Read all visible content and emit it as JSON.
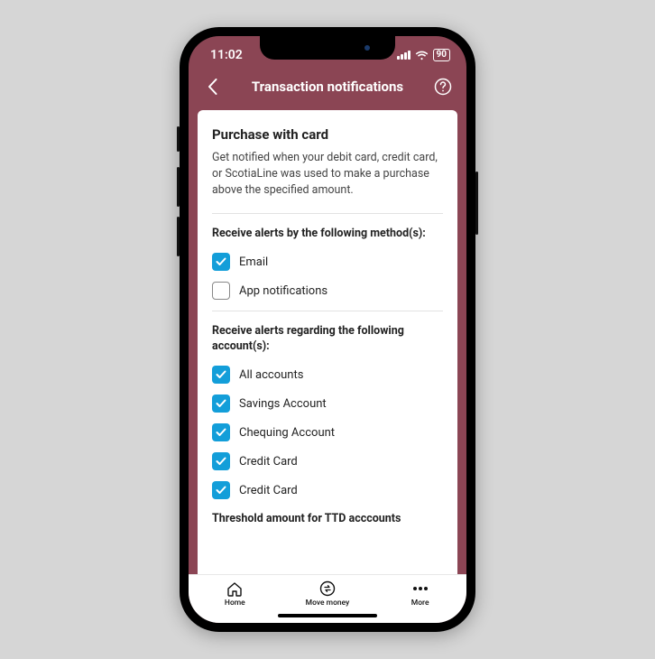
{
  "status": {
    "time": "11:02",
    "battery": "90"
  },
  "nav": {
    "title": "Transaction notifications"
  },
  "card": {
    "title": "Purchase with card",
    "description": "Get notified when your debit card, credit card, or ScotiaLine was used to make a purchase above the specified amount.",
    "methods_heading": "Receive alerts by the following method(s):",
    "methods": [
      {
        "label": "Email",
        "checked": true
      },
      {
        "label": "App notifications",
        "checked": false
      }
    ],
    "accounts_heading": "Receive alerts regarding the following account(s):",
    "accounts": [
      {
        "label": "All accounts",
        "checked": true
      },
      {
        "label": "Savings Account",
        "checked": true
      },
      {
        "label": "Chequing Account",
        "checked": true
      },
      {
        "label": "Credit Card",
        "checked": true
      },
      {
        "label": "Credit Card",
        "checked": true
      }
    ],
    "threshold_heading": "Threshold amount for TTD acccounts"
  },
  "bottom_nav": {
    "home": "Home",
    "move": "Move money",
    "more": "More"
  },
  "colors": {
    "brand": "#8b4554",
    "accent": "#139ed9"
  }
}
